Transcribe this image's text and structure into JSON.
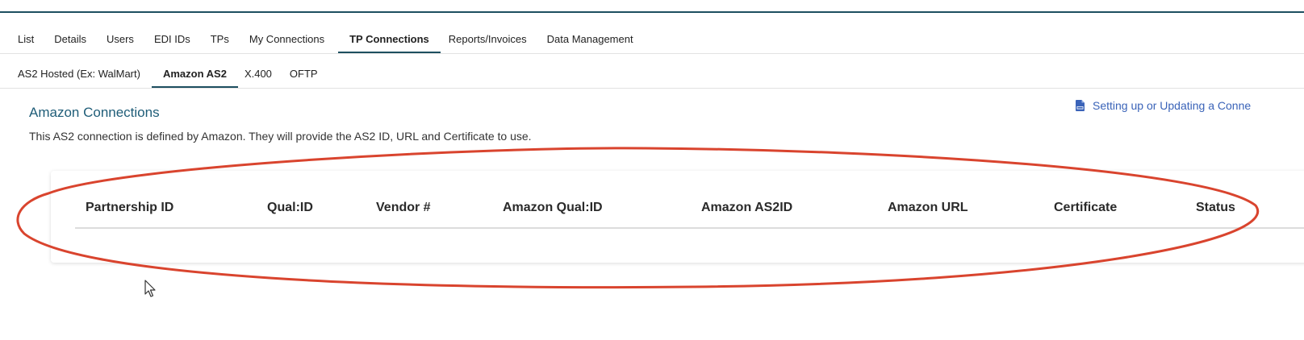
{
  "primary_tabs": [
    {
      "label": "List",
      "active": false
    },
    {
      "label": "Details",
      "active": false
    },
    {
      "label": "Users",
      "active": false
    },
    {
      "label": "EDI IDs",
      "active": false
    },
    {
      "label": "TPs",
      "active": false
    },
    {
      "label": "My Connections",
      "active": false
    },
    {
      "label": "TP Connections",
      "active": true
    },
    {
      "label": "Reports/Invoices",
      "active": false
    },
    {
      "label": "Data Management",
      "active": false
    }
  ],
  "secondary_tabs": [
    {
      "label": "AS2 Hosted (Ex: WalMart)",
      "active": false
    },
    {
      "label": "Amazon AS2",
      "active": true
    },
    {
      "label": "X.400",
      "active": false
    },
    {
      "label": "OFTP",
      "active": false
    }
  ],
  "section": {
    "title": "Amazon Connections",
    "description": "This AS2 connection is defined by Amazon. They will provide the AS2 ID, URL and Certificate to use.",
    "help_link": "Setting up or Updating a Conne",
    "help_icon": "pdf-file-icon"
  },
  "table": {
    "columns": [
      "Partnership ID",
      "Qual:ID",
      "Vendor #",
      "Amazon Qual:ID",
      "Amazon AS2ID",
      "Amazon URL",
      "Certificate",
      "Status"
    ],
    "rows": []
  },
  "colors": {
    "accent": "#1d4f60",
    "title": "#1f5d78",
    "link": "#3a63b8",
    "annotation": "#d9442e"
  }
}
